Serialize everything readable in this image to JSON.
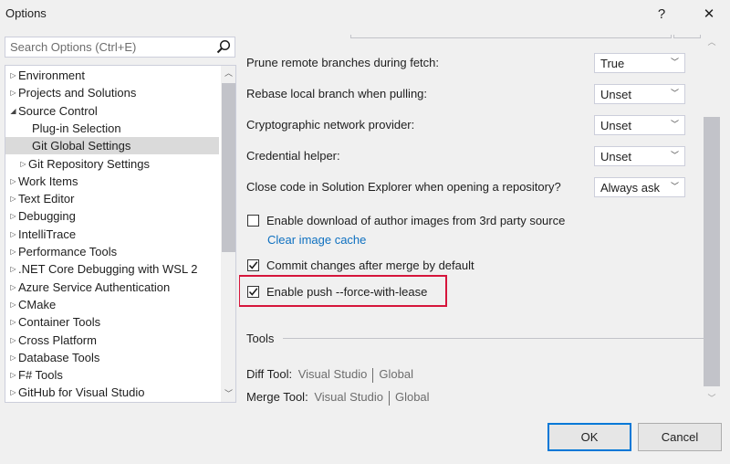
{
  "window": {
    "title": "Options",
    "help_label": "?",
    "close_label": "✕"
  },
  "search": {
    "placeholder": "Search Options (Ctrl+E)",
    "value": ""
  },
  "tree": {
    "items": [
      {
        "label": "Environment",
        "indent": 0,
        "arrow": "right"
      },
      {
        "label": "Projects and Solutions",
        "indent": 0,
        "arrow": "right"
      },
      {
        "label": "Source Control",
        "indent": 0,
        "arrow": "down"
      },
      {
        "label": "Plug-in Selection",
        "indent": 1,
        "arrow": "none"
      },
      {
        "label": "Git Global Settings",
        "indent": 1,
        "arrow": "none",
        "selected": true
      },
      {
        "label": "Git Repository Settings",
        "indent": 1,
        "arrow": "right"
      },
      {
        "label": "Work Items",
        "indent": 0,
        "arrow": "right"
      },
      {
        "label": "Text Editor",
        "indent": 0,
        "arrow": "right"
      },
      {
        "label": "Debugging",
        "indent": 0,
        "arrow": "right"
      },
      {
        "label": "IntelliTrace",
        "indent": 0,
        "arrow": "right"
      },
      {
        "label": "Performance Tools",
        "indent": 0,
        "arrow": "right"
      },
      {
        "label": ".NET Core Debugging with WSL 2",
        "indent": 0,
        "arrow": "right"
      },
      {
        "label": "Azure Service Authentication",
        "indent": 0,
        "arrow": "right"
      },
      {
        "label": "CMake",
        "indent": 0,
        "arrow": "right"
      },
      {
        "label": "Container Tools",
        "indent": 0,
        "arrow": "right"
      },
      {
        "label": "Cross Platform",
        "indent": 0,
        "arrow": "right"
      },
      {
        "label": "Database Tools",
        "indent": 0,
        "arrow": "right"
      },
      {
        "label": "F# Tools",
        "indent": 0,
        "arrow": "right"
      },
      {
        "label": "GitHub for Visual Studio",
        "indent": 0,
        "arrow": "right"
      }
    ]
  },
  "settings": {
    "prune": {
      "label": "Prune remote branches during fetch:",
      "value": "True"
    },
    "rebase": {
      "label": "Rebase local branch when pulling:",
      "value": "Unset"
    },
    "crypto": {
      "label": "Cryptographic network provider:",
      "value": "Unset"
    },
    "credential": {
      "label": "Credential helper:",
      "value": "Unset"
    },
    "close_code": {
      "label": "Close code in Solution Explorer when opening a repository?",
      "value": "Always ask"
    },
    "author_images": {
      "label": "Enable download of author images from 3rd party source",
      "checked": false
    },
    "clear_cache": {
      "label": "Clear image cache"
    },
    "commit_merge": {
      "label": "Commit changes after merge by default",
      "checked": true
    },
    "force_lease": {
      "label_prefix": "Enable push ",
      "label_code": "--force-with-lease",
      "checked": true
    }
  },
  "tools": {
    "section_title": "Tools",
    "diff": {
      "label": "Diff Tool:",
      "value": "Visual Studio",
      "scope": "Global"
    },
    "merge": {
      "label": "Merge Tool:",
      "value": "Visual Studio",
      "scope": "Global"
    }
  },
  "buttons": {
    "ok": "OK",
    "cancel": "Cancel"
  },
  "colors": {
    "accent": "#0078d7",
    "highlight": "#d6153b",
    "link": "#0e70c0"
  }
}
